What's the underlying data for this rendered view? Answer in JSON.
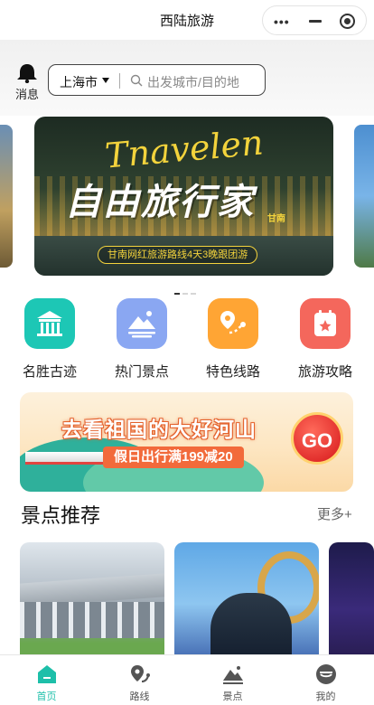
{
  "app": {
    "title": "西陆旅游"
  },
  "header": {
    "notification_label": "消息",
    "city": "上海市",
    "search_placeholder": "出发城市/目的地"
  },
  "banner": {
    "script_text": "Tnavelen",
    "headline": "自由旅行家",
    "small_label": "甘南",
    "tagline": "甘南网红旅游路线4天3晚跟团游",
    "pages": 3,
    "active_page": 1
  },
  "categories": [
    {
      "label": "名胜古迹",
      "icon": "temple-icon",
      "color": "#1dc7b5"
    },
    {
      "label": "热门景点",
      "icon": "mountain-icon",
      "color": "#8aa7f2"
    },
    {
      "label": "特色线路",
      "icon": "route-icon",
      "color": "#ffa534"
    },
    {
      "label": "旅游攻略",
      "icon": "guide-icon",
      "color": "#f4675c"
    }
  ],
  "promo": {
    "title": "去看祖国的大好河山",
    "subtitle": "假日出行满199减20",
    "go_label": "GO"
  },
  "recommend": {
    "title": "景点推荐",
    "more_label": "更多+",
    "cards": [
      {
        "name": "exhibition-hall"
      },
      {
        "name": "ocean-park"
      },
      {
        "name": "night-scene"
      }
    ]
  },
  "tabbar": {
    "active_color": "#1dbfa9",
    "items": [
      {
        "label": "首页",
        "icon": "home-icon",
        "active": true
      },
      {
        "label": "路线",
        "icon": "route-map-icon",
        "active": false
      },
      {
        "label": "景点",
        "icon": "scenery-icon",
        "active": false
      },
      {
        "label": "我的",
        "icon": "profile-icon",
        "active": false
      }
    ]
  }
}
